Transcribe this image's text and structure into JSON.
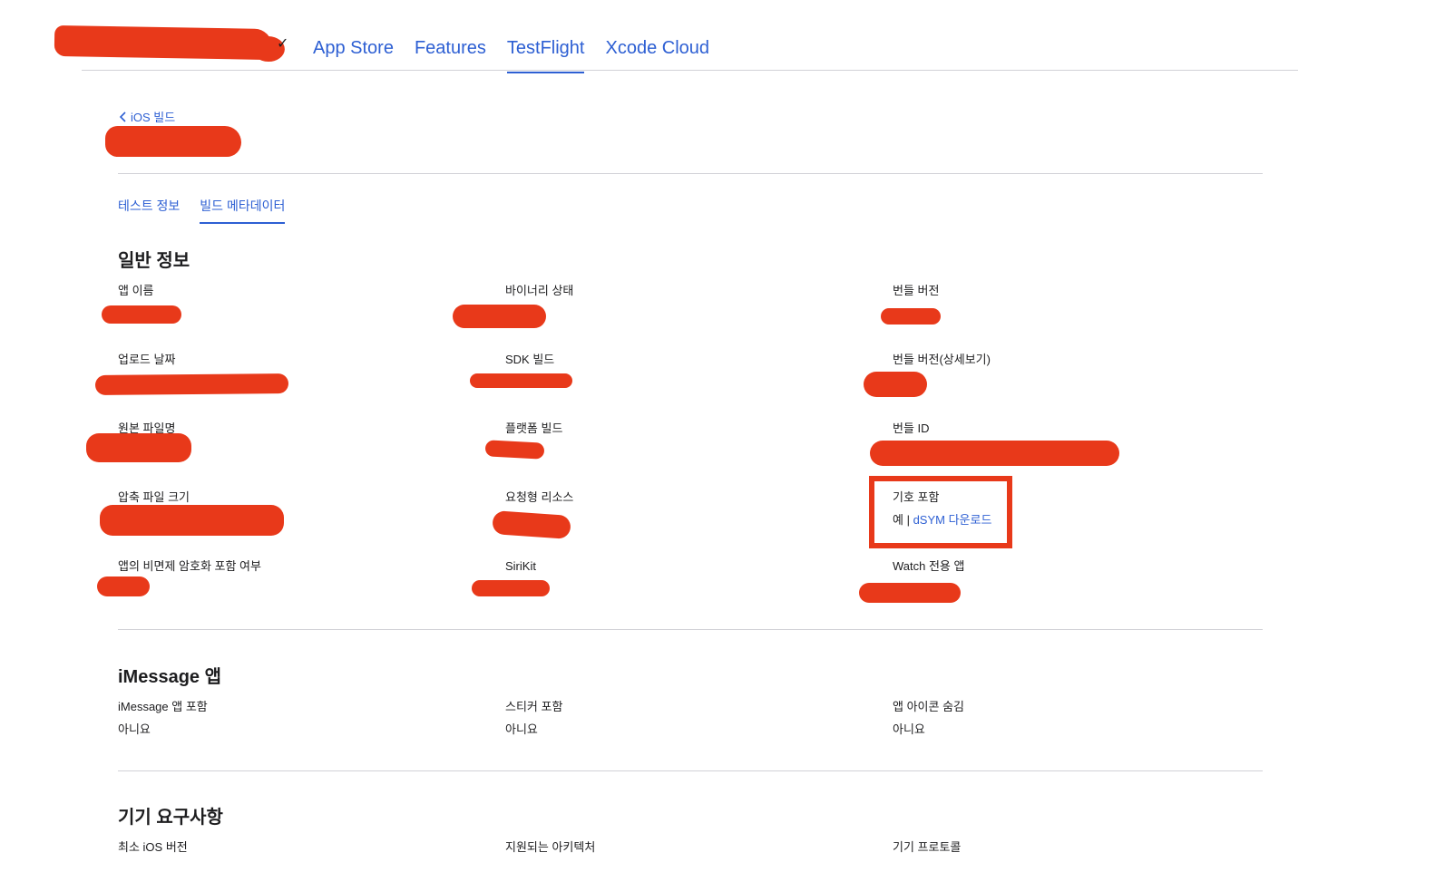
{
  "nav": {
    "links": [
      "App Store",
      "Features",
      "TestFlight",
      "Xcode Cloud"
    ]
  },
  "breadcrumb": {
    "back_label": "iOS 빌드"
  },
  "tabs": [
    "테스트 정보",
    "빌드 메타데이터"
  ],
  "general": {
    "title": "일반 정보",
    "fields": {
      "app_name": {
        "label": "앱 이름"
      },
      "binary_state": {
        "label": "바이너리 상태"
      },
      "bundle_version": {
        "label": "번들 버전"
      },
      "upload_date": {
        "label": "업로드 날짜"
      },
      "sdk_build": {
        "label": "SDK 빌드"
      },
      "bundle_version_short": {
        "label": "번들 버전(상세보기)"
      },
      "original_filename": {
        "label": "원본 파일명"
      },
      "platform_build": {
        "label": "플랫폼 빌드"
      },
      "bundle_id": {
        "label": "번들 ID"
      },
      "compressed_size": {
        "label": "압축 파일 크기"
      },
      "on_demand": {
        "label": "요청형 리소스"
      },
      "symbols": {
        "label": "기호 포함",
        "value": "예 |",
        "link": "dSYM 다운로드"
      },
      "encryption": {
        "label": "앱의 비면제 암호화 포함 여부"
      },
      "sirikit": {
        "label": "SiriKit"
      },
      "watch_app": {
        "label": "Watch 전용 앱"
      }
    }
  },
  "imessage": {
    "title": "iMessage 앱",
    "fields": {
      "includes_app": {
        "label": "iMessage 앱 포함",
        "value": "아니요"
      },
      "stickers": {
        "label": "스티커 포함",
        "value": "아니요"
      },
      "hide_icon": {
        "label": "앱 아이콘 숨김",
        "value": "아니요"
      }
    }
  },
  "device": {
    "title": "기기 요구사항",
    "fields": {
      "min_ios": {
        "label": "최소 iOS 버전"
      },
      "architectures": {
        "label": "지원되는 아키텍처"
      },
      "protocols": {
        "label": "기기 프로토콜"
      }
    }
  }
}
